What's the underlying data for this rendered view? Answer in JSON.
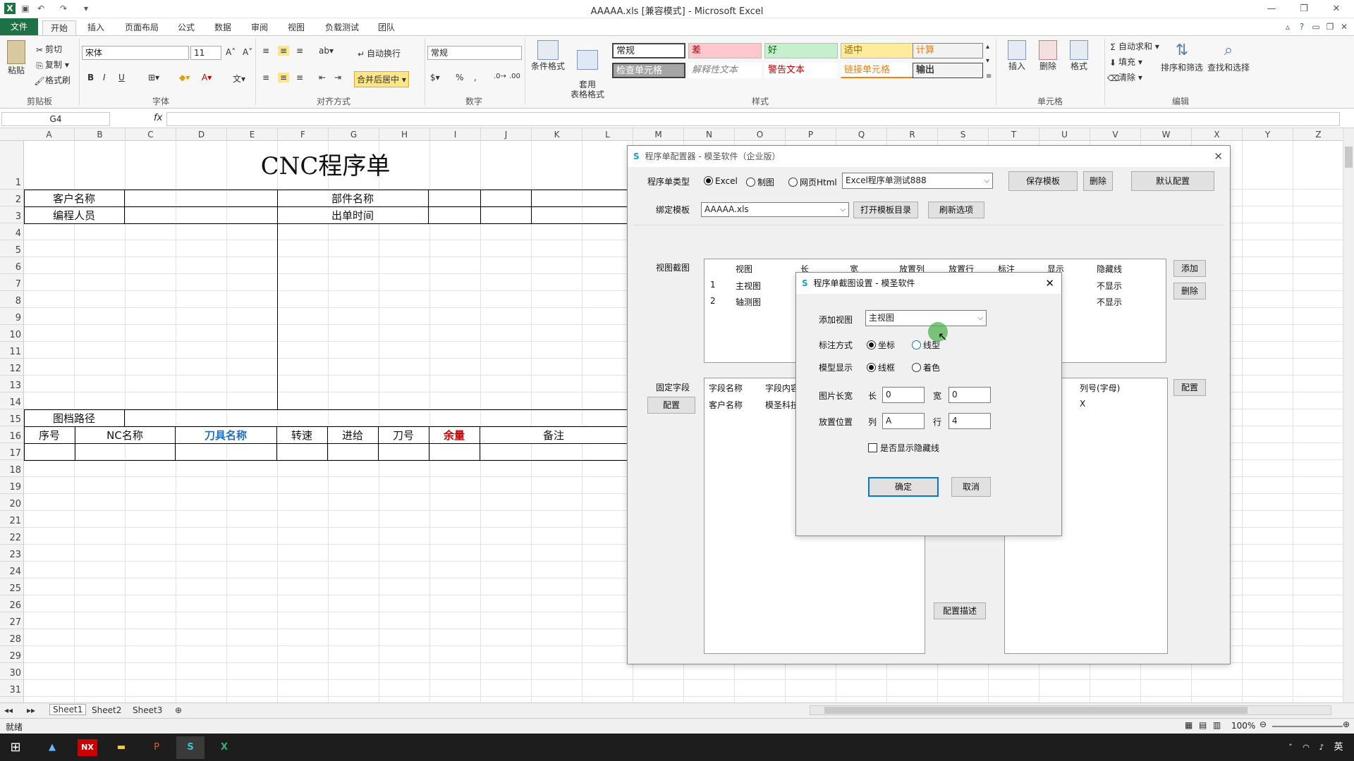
{
  "window": {
    "title": "AAAAA.xls  [兼容模式] - Microsoft Excel"
  },
  "tabs": [
    "文件",
    "开始",
    "插入",
    "页面布局",
    "公式",
    "数据",
    "审阅",
    "视图",
    "负载测试",
    "团队"
  ],
  "ribbon": {
    "clipboard": {
      "paste": "粘贴",
      "cut": "剪切",
      "copy": "复制",
      "format_painter": "格式刷",
      "label": "剪贴板"
    },
    "font": {
      "name": "宋体",
      "size": "11",
      "bold": "B",
      "italic": "I",
      "underline": "U",
      "label": "字体"
    },
    "alignment": {
      "wrap": "自动换行",
      "merge": "合并后居中",
      "label": "对齐方式"
    },
    "number": {
      "format": "常规",
      "percent": "%",
      "comma": ",",
      "label": "数字"
    },
    "styles": {
      "cond_format": "条件格式",
      "table_format": "套用\n表格格式",
      "cells": [
        "常规",
        "差",
        "好",
        "适中",
        "计算",
        "检查单元格",
        "解释性文本",
        "警告文本",
        "链接单元格",
        "输出"
      ],
      "label": "样式"
    },
    "cells": {
      "insert": "插入",
      "delete": "删除",
      "format": "格式",
      "label": "单元格"
    },
    "editing": {
      "autosum": "自动求和",
      "fill": "填充",
      "clear": "清除",
      "sort": "排序和筛选",
      "find": "查找和选择",
      "label": "编辑"
    }
  },
  "formula_bar": {
    "name_box": "G4",
    "fx": "fx",
    "value": ""
  },
  "columns": [
    "A",
    "B",
    "C",
    "D",
    "E",
    "F",
    "G",
    "H",
    "I",
    "J",
    "K",
    "L",
    "M",
    "N",
    "O",
    "P",
    "Q",
    "R",
    "S",
    "T",
    "U",
    "V",
    "W",
    "X",
    "Y",
    "Z"
  ],
  "rows": [
    "1",
    "2",
    "3",
    "4",
    "5",
    "6",
    "7",
    "8",
    "9",
    "10",
    "11",
    "12",
    "13",
    "14",
    "15",
    "16",
    "17",
    "18",
    "19",
    "20",
    "21",
    "22",
    "23",
    "24",
    "25",
    "26",
    "27",
    "28",
    "29",
    "30",
    "31"
  ],
  "sheet": {
    "title": "CNC程序单",
    "customer": "客户名称",
    "part": "部件名称",
    "programmer": "编程人员",
    "issue_time": "出单时间",
    "file_path": "图档路径",
    "headers": [
      "序号",
      "NC名称",
      "刀具名称",
      "转速",
      "进给",
      "刀号",
      "余量",
      "备注"
    ],
    "header_colors": {
      "tool": "#1f6fbf",
      "allowance": "#c00000"
    }
  },
  "sheet_tabs": [
    "Sheet1",
    "Sheet2",
    "Sheet3"
  ],
  "status": {
    "ready": "就绪",
    "zoom": "100%"
  },
  "configurator": {
    "title": "程序单配置器 - 模圣软件（企业版）",
    "type_label": "程序单类型",
    "type_options": [
      "Excel",
      "制图",
      "网页Html"
    ],
    "template_name": "Excel程序单测试888",
    "save_template": "保存模板",
    "delete": "删除",
    "default_config": "默认配置",
    "bind_label": "绑定模板",
    "bind_file": "AAAAA.xls",
    "open_dir": "打开模板目录",
    "refresh": "刷新选项",
    "view_label": "视图截图",
    "view_cols": [
      "视图",
      "长",
      "宽",
      "放置列",
      "放置行",
      "标注",
      "显示",
      "隐藏线"
    ],
    "view_rows": [
      {
        "n": "1",
        "name": "主视图",
        "hidden": "不显示"
      },
      {
        "n": "2",
        "name": "轴测图",
        "hidden": "不显示"
      }
    ],
    "add": "添加",
    "remove": "删除",
    "fixed_label": "固定字段",
    "config": "配置",
    "fixed_cols": [
      "字段名称",
      "字段内容"
    ],
    "fixed_rows": [
      {
        "name": "客户名称",
        "value": "模圣科技"
      }
    ],
    "col_label": "列号(字母)",
    "col_value": "X",
    "config2": "配置",
    "config_desc": "配置描述"
  },
  "view_dialog": {
    "title": "程序单截图设置 - 模圣软件",
    "add_view": "添加视图",
    "view_value": "主视图",
    "mark_label": "标注方式",
    "mark_options": [
      "坐标",
      "线型"
    ],
    "model_label": "模型显示",
    "model_options": [
      "线框",
      "着色"
    ],
    "size_label": "图片长宽",
    "len_label": "长",
    "len_value": "0",
    "wid_label": "宽",
    "wid_value": "0",
    "place_label": "放置位置",
    "col_label": "列",
    "col_value": "A",
    "row_label": "行",
    "row_value": "4",
    "hidden_line": "是否显示隐藏线",
    "ok": "确定",
    "cancel": "取消"
  },
  "taskbar": {
    "time": "英"
  }
}
